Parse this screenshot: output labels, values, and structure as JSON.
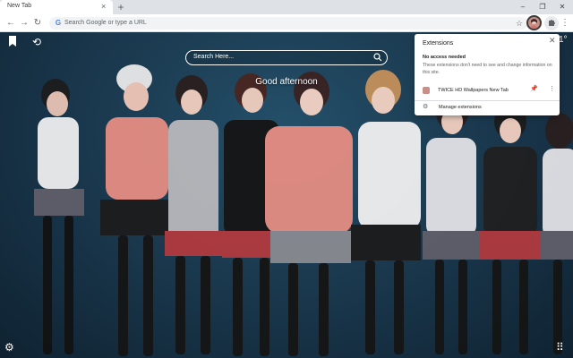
{
  "tab": {
    "title": "New Tab",
    "close_icon": "close-icon"
  },
  "toolbar": {
    "address_placeholder": "Search Google or type a URL"
  },
  "content": {
    "search_placeholder": "Search Here...",
    "greeting": "Good afternoon",
    "clock_fragment": "1°"
  },
  "extensions_popup": {
    "title": "Extensions",
    "section_heading": "No access needed",
    "section_description": "These extensions don't need to see and change information on this site.",
    "extension_name": "TWICE HD Wallpapers New Tab",
    "manage_label": "Manage extensions"
  },
  "colors": {
    "tabstrip": "#dee1e6",
    "wallpaper_bg": "#1b3a50",
    "accent_blue": "#1a73e8"
  }
}
